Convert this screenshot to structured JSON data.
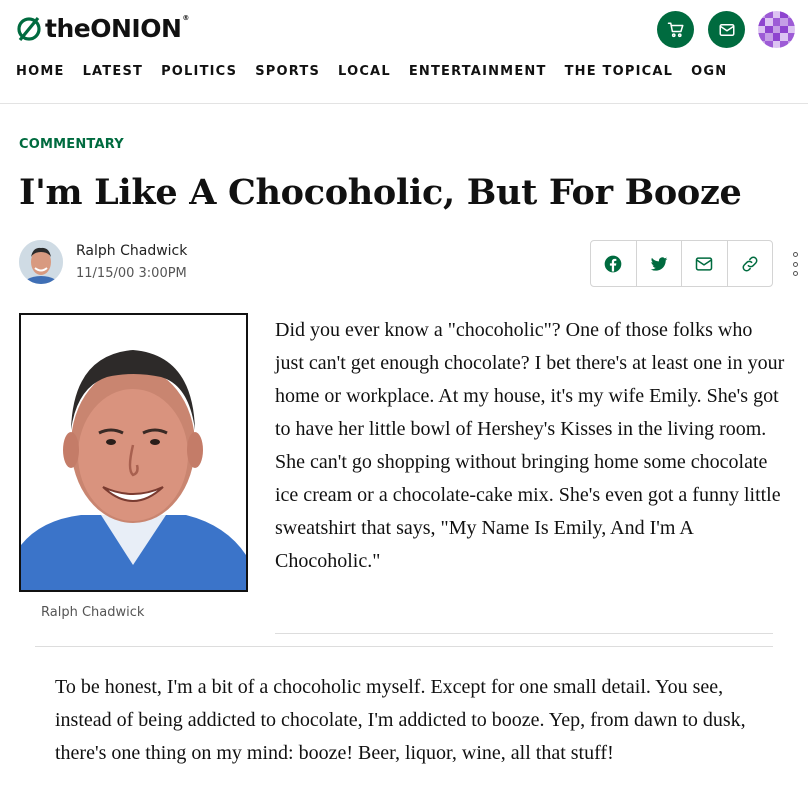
{
  "site": {
    "logo_the": "the",
    "logo_onion": "ONION",
    "logo_reg": "®",
    "brand_color": "#006b3f"
  },
  "header_buttons": [
    {
      "name": "cart-icon"
    },
    {
      "name": "mail-icon"
    },
    {
      "name": "user-avatar"
    }
  ],
  "nav": {
    "items": [
      "HOME",
      "LATEST",
      "POLITICS",
      "SPORTS",
      "LOCAL",
      "ENTERTAINMENT",
      "THE TOPICAL",
      "OGN"
    ]
  },
  "article": {
    "category": "COMMENTARY",
    "headline": "I'm Like A Chocoholic, But For Booze",
    "author": "Ralph Chadwick",
    "date": "11/15/00 3:00PM",
    "share_icons": [
      "facebook-icon",
      "twitter-icon",
      "email-icon",
      "link-icon"
    ],
    "photo_caption": "Ralph Chadwick",
    "paragraphs": [
      "Did you ever know a \"chocoholic\"? One of those folks who just can't get enough chocolate? I bet there's at least one in your home or workplace. At my house, it's my wife Emily. She's got to have her little bowl of Hershey's Kisses in the living room. She can't go shopping without bringing home some chocolate ice cream or a chocolate-cake mix. She's even got a funny little sweatshirt that says, \"My Name Is Emily, And I'm A Chocoholic.\"",
      "To be honest, I'm a bit of a chocoholic myself. Except for one small detail. You see, instead of being addicted to chocolate, I'm addicted to booze. Yep, from dawn to dusk, there's one thing on my mind: booze! Beer, liquor, wine, all that stuff!"
    ]
  }
}
